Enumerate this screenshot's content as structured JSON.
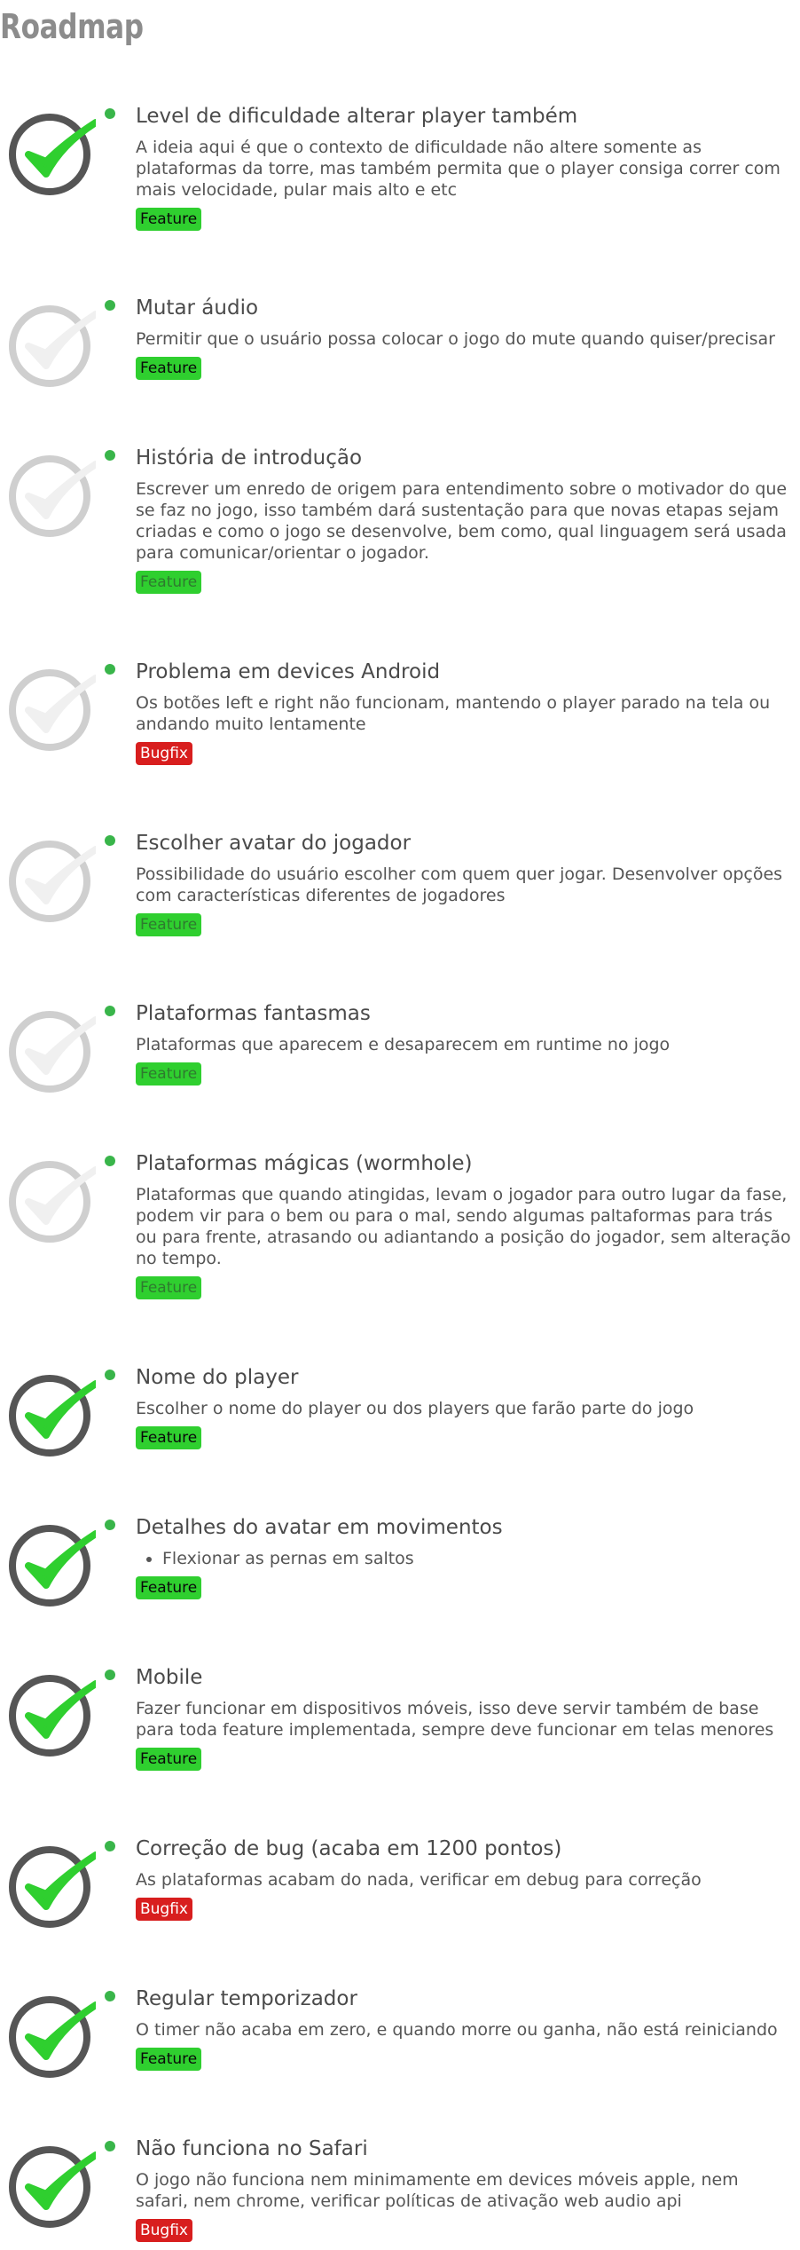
{
  "page": {
    "title": "Roadmap"
  },
  "items": [
    {
      "title": "Level de dificuldade alterar player também",
      "description": "A ideia aqui é que o contexto de dificuldade não altere somente as plataformas da torre, mas também permita que o player consiga correr com mais velocidade, pular mais alto e etc",
      "tag": "Feature",
      "status": "done"
    },
    {
      "title": "Mutar áudio",
      "description": "Permitir que o usuário possa colocar o jogo do mute quando quiser/precisar",
      "tag": "Feature",
      "status": "todo"
    },
    {
      "title": "História de introdução",
      "description": "Escrever um enredo de origem para entendimento sobre o motivador do que se faz no jogo, isso também dará sustentação para que novas etapas sejam criadas e como o jogo se desenvolve, bem como, qual linguagem será usada para comunicar/orientar o jogador.",
      "tag": "Feature",
      "status": "todo"
    },
    {
      "title": "Problema em devices Android",
      "description": "Os botões left e right não funcionam, mantendo o player parado na tela ou andando muito lentamente",
      "tag": "Bugfix",
      "status": "todo"
    },
    {
      "title": "Escolher avatar do jogador",
      "description": "Possibilidade do usuário escolher com quem quer jogar. Desenvolver opções com características diferentes de jogadores",
      "tag": "Feature",
      "status": "todo"
    },
    {
      "title": "Plataformas fantasmas",
      "description": "Plataformas que aparecem e desaparecem em runtime no jogo",
      "tag": "Feature",
      "status": "todo"
    },
    {
      "title": "Plataformas mágicas (wormhole)",
      "description": "Plataformas que quando atingidas, levam o jogador para outro lugar da fase, podem vir para o bem ou para o mal, sendo algumas paltaformas para trás ou para frente, atrasando ou adiantando a posição do jogador, sem alteração no tempo.",
      "tag": "Feature",
      "status": "todo"
    },
    {
      "title": "Nome do player",
      "description": "Escolher o nome do player ou dos players que farão parte do jogo",
      "tag": "Feature",
      "status": "done"
    },
    {
      "title": "Detalhes do avatar em movimentos",
      "bullet": "Flexionar as pernas em saltos",
      "tag": "Feature",
      "status": "done"
    },
    {
      "title": "Mobile",
      "description": "Fazer funcionar em dispositivos móveis, isso deve servir também de base para toda feature implementada, sempre deve funcionar em telas menores",
      "tag": "Feature",
      "status": "done"
    },
    {
      "title": "Correção de bug (acaba em 1200 pontos)",
      "description": "As plataformas acabam do nada, verificar em debug para correção",
      "tag": "Bugfix",
      "status": "done"
    },
    {
      "title": "Regular temporizador",
      "description": "O timer não acaba em zero, e quando morre ou ganha, não está reiniciando",
      "tag": "Feature",
      "status": "done"
    },
    {
      "title": "Não funciona no Safari",
      "description": "O jogo não funciona nem minimamente em devices móveis apple, nem safari, nem chrome, verificar políticas de ativação web audio api",
      "tag": "Bugfix",
      "status": "done"
    }
  ]
}
